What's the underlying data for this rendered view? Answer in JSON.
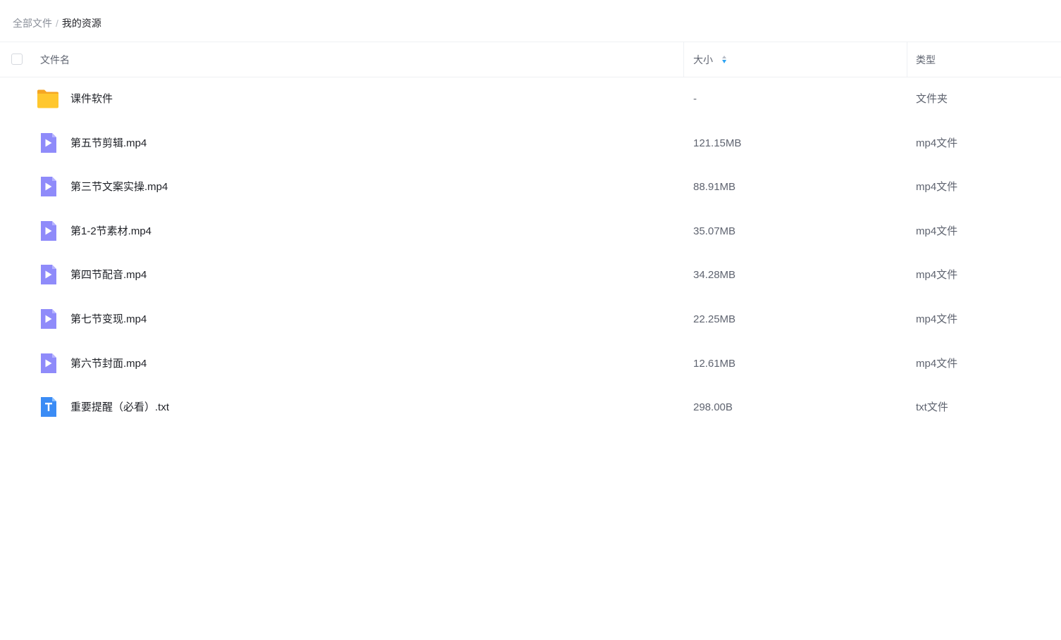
{
  "breadcrumb": {
    "root": "全部文件",
    "separator": "/",
    "current": "我的资源"
  },
  "table": {
    "headers": {
      "name": "文件名",
      "size": "大小",
      "type": "类型"
    },
    "sort": {
      "column": "size",
      "direction": "descending"
    },
    "rows": [
      {
        "icon": "folder-icon",
        "name": "课件软件",
        "size": "-",
        "type": "文件夹"
      },
      {
        "icon": "video-file-icon",
        "name": "第五节剪辑.mp4",
        "size": "121.15MB",
        "type": "mp4文件"
      },
      {
        "icon": "video-file-icon",
        "name": "第三节文案实操.mp4",
        "size": "88.91MB",
        "type": "mp4文件"
      },
      {
        "icon": "video-file-icon",
        "name": "第1-2节素材.mp4",
        "size": "35.07MB",
        "type": "mp4文件"
      },
      {
        "icon": "video-file-icon",
        "name": "第四节配音.mp4",
        "size": "34.28MB",
        "type": "mp4文件"
      },
      {
        "icon": "video-file-icon",
        "name": "第七节变现.mp4",
        "size": "22.25MB",
        "type": "mp4文件"
      },
      {
        "icon": "video-file-icon",
        "name": "第六节封面.mp4",
        "size": "12.61MB",
        "type": "mp4文件"
      },
      {
        "icon": "text-file-icon",
        "name": "重要提醒（必看）.txt",
        "size": "298.00B",
        "type": "txt文件"
      }
    ]
  },
  "colors": {
    "folder": "#FFC32E",
    "video": "#8F8BFA",
    "text_file": "#3B8CF5",
    "sort_active": "#2EA3F2"
  }
}
